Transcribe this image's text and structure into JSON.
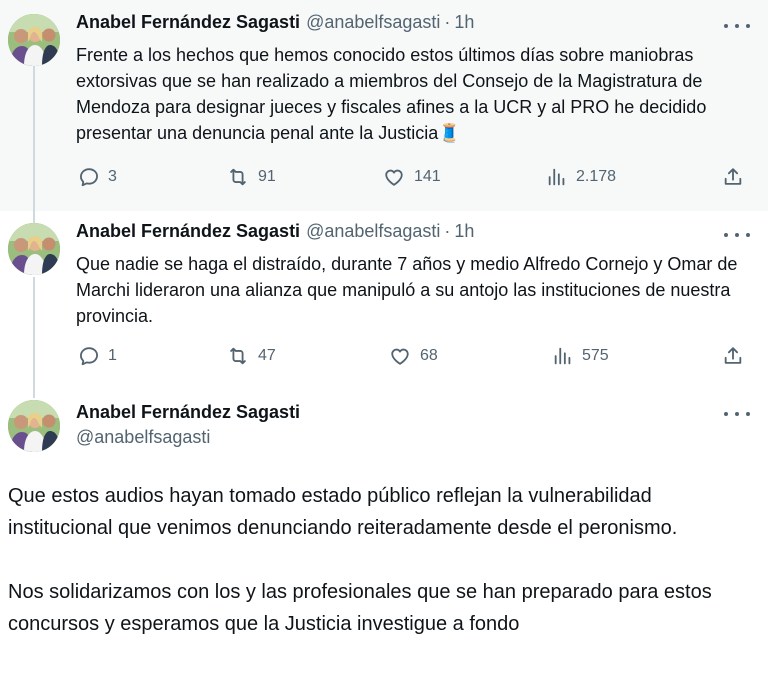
{
  "tweets": [
    {
      "author": "Anabel Fernández Sagasti",
      "handle": "@anabelfsagasti",
      "separator": "·",
      "time": "1h",
      "text": "Frente a los hechos que hemos conocido estos últimos días sobre maniobras extorsivas que se han realizado a miembros del Consejo de la Magistratura de Mendoza para designar jueces y fiscales afines a la UCR y al PRO he decidido presentar una denuncia penal ante la Justicia",
      "emoji": "🧵",
      "replies": "3",
      "retweets": "91",
      "likes": "141",
      "views": "2.178"
    },
    {
      "author": "Anabel Fernández Sagasti",
      "handle": "@anabelfsagasti",
      "separator": "·",
      "time": "1h",
      "text": "Que nadie se haga el distraído, durante 7 años y medio Alfredo Cornejo y Omar de Marchi lideraron una alianza que manipuló a su antojo las instituciones de nuestra provincia.",
      "replies": "1",
      "retweets": "47",
      "likes": "68",
      "views": "575"
    },
    {
      "author": "Anabel Fernández Sagasti",
      "handle": "@anabelfsagasti",
      "paragraph1": "Que estos audios hayan tomado estado público reflejan la vulnerabilidad institucional que venimos denunciando reiteradamente desde el peronismo.",
      "paragraph2": "Nos solidarizamos con los y las profesionales que se han preparado para estos concursos y esperamos que la Justicia investigue a fondo"
    }
  ],
  "icons": {
    "reply": "reply-icon",
    "retweet": "retweet-icon",
    "like": "heart-icon",
    "views": "views-icon",
    "share": "share-icon",
    "more": "more-icon"
  },
  "colors": {
    "text": "#0f1419",
    "secondary": "#536471",
    "highlight_bg": "#f7f9f9",
    "thread_line": "#cfd9de"
  }
}
